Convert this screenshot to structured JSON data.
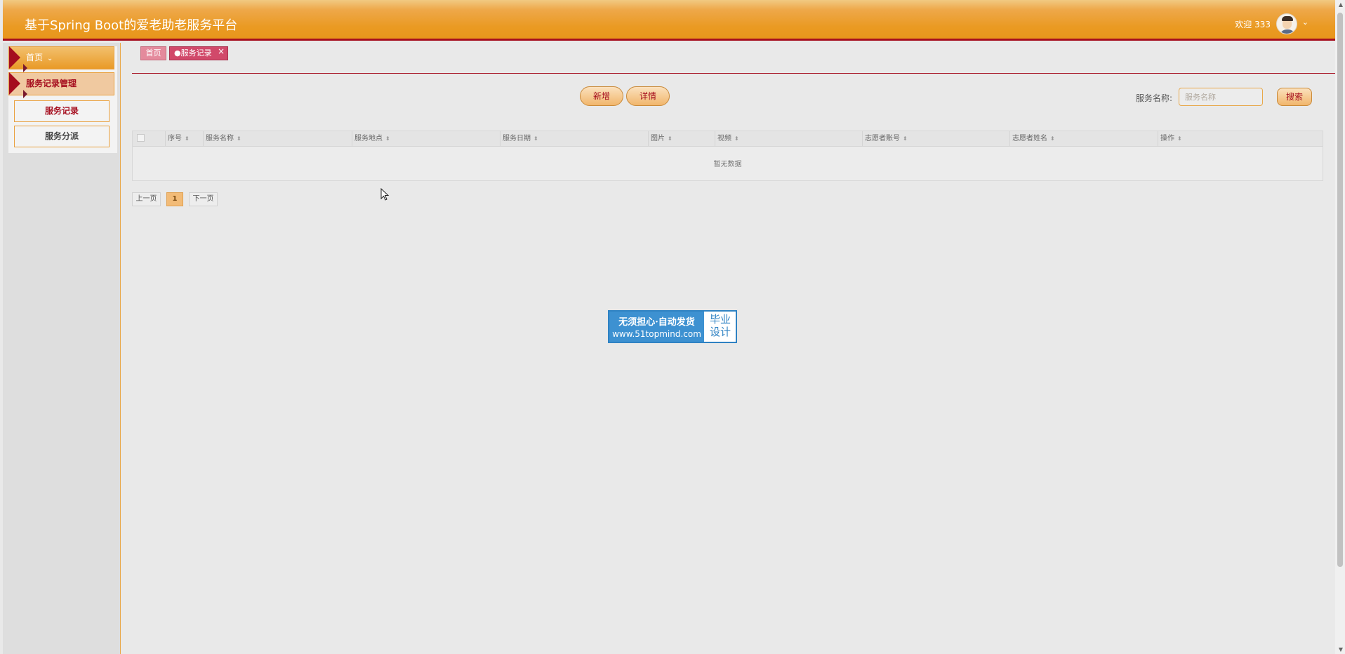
{
  "header": {
    "title": "基于Spring Boot的爱老助老服务平台",
    "welcome": "欢迎 333",
    "avatar_icon": "user-avatar",
    "caret_icon": "chevron-down-icon"
  },
  "sidebar": {
    "items": [
      {
        "label": "首页",
        "icon": "arrow-right-icon"
      },
      {
        "label": "服务记录管理",
        "icon": "arrow-right-icon"
      }
    ],
    "subitems": [
      {
        "label": "服务记录"
      },
      {
        "label": "服务分派"
      }
    ]
  },
  "tabs": [
    {
      "label": "首页"
    },
    {
      "label": "●服务记录",
      "close": "×"
    }
  ],
  "toolbar": {
    "add_label": "新增",
    "detail_label": "详情"
  },
  "search": {
    "label": "服务名称:",
    "placeholder": "服务名称",
    "button_label": "搜索"
  },
  "table": {
    "columns": [
      "序号",
      "服务名称",
      "服务地点",
      "服务日期",
      "图片",
      "视频",
      "志愿者账号",
      "志愿者姓名",
      "操作"
    ],
    "empty_text": "暂无数据"
  },
  "pagination": {
    "prev_label": "上一页",
    "current_page": "1",
    "next_label": "下一页"
  },
  "watermark": {
    "line1": "无须担心·自动发货",
    "line2": "www.51topmind.com",
    "right_line1": "毕业",
    "right_line2": "设计"
  },
  "colors": {
    "header_gradient": "#ea9a22",
    "accent_red": "#a50d1e",
    "border_orange": "#e9a03e",
    "tab_active": "#d1496a"
  }
}
